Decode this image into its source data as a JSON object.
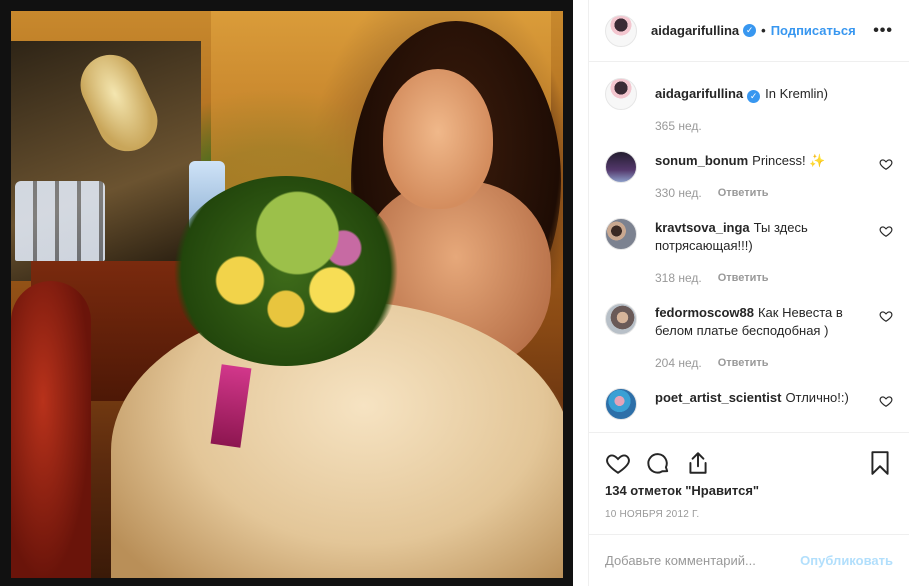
{
  "header": {
    "username": "aidagarifullina",
    "verified_mark": "✓",
    "dot": "•",
    "follow_label": "Подписаться",
    "more_label": "•••"
  },
  "caption": {
    "username": "aidagarifullina",
    "verified_mark": "✓",
    "text": "In Kremlin)",
    "time": "365 нед."
  },
  "comments": [
    {
      "username": "sonum_bonum",
      "text": "Princess! ✨",
      "time": "330 нед.",
      "reply": "Ответить"
    },
    {
      "username": "kravtsova_inga",
      "text": "Ты здесь потрясающая!!!)",
      "time": "318 нед.",
      "reply": "Ответить"
    },
    {
      "username": "fedormoscow88",
      "text": "Как Невеста в белом платье бесподобная )",
      "time": "204 нед.",
      "reply": "Ответить"
    },
    {
      "username": "poet_artist_scientist",
      "text": "Отлично!:)",
      "time": "",
      "reply": ""
    }
  ],
  "actions": {
    "icons": [
      "heart-icon",
      "comment-icon",
      "share-icon",
      "bookmark-icon"
    ],
    "likes": "134 отметок \"Нравится\"",
    "date": "10 НОЯБРЯ 2012 Г."
  },
  "add_comment": {
    "placeholder": "Добавьте комментарий...",
    "publish_label": "Опубликовать"
  },
  "colors": {
    "accent": "#3897f0",
    "publish_disabled": "#b2dffc",
    "muted": "#999999"
  }
}
